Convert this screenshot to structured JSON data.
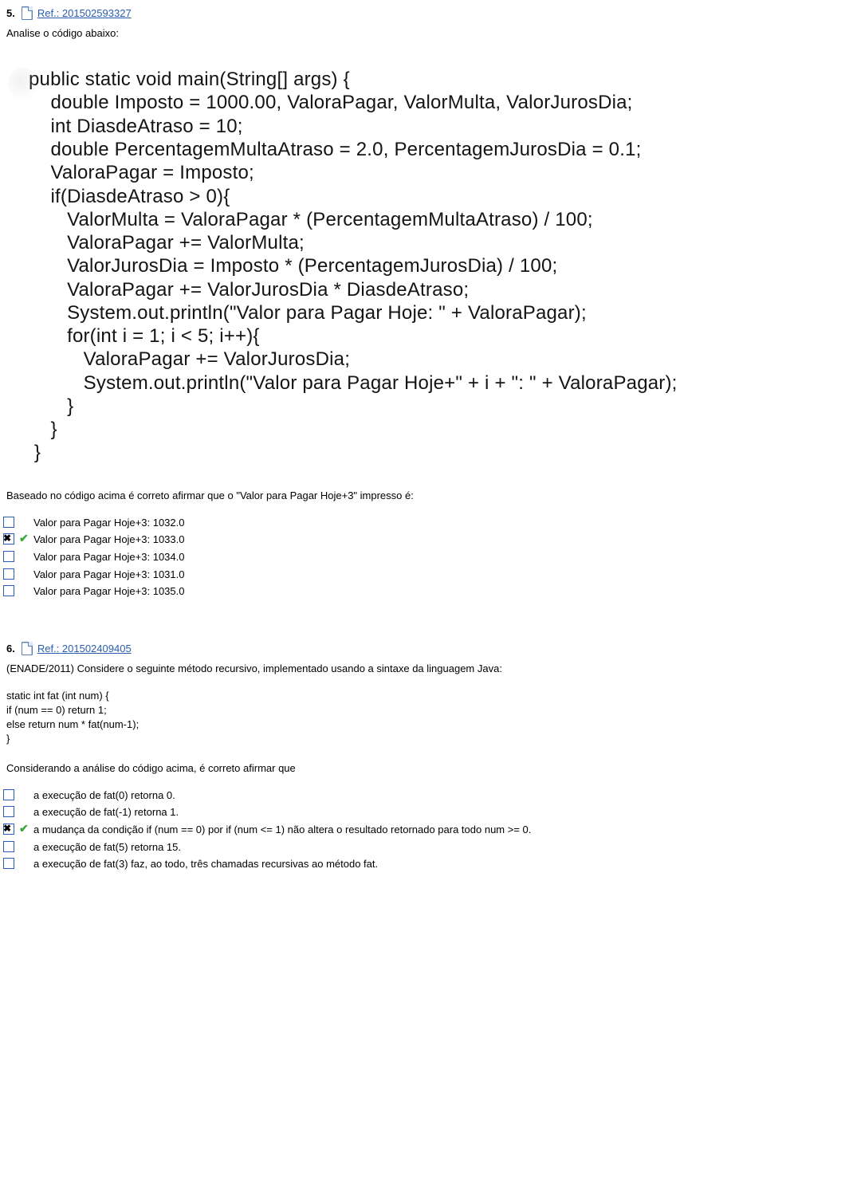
{
  "q1": {
    "number": "5.",
    "ref_label": "Ref.: 201502593327",
    "stem": "Analise o código abaixo:",
    "code": "public static void main(String[] args) {\n    double Imposto = 1000.00, ValoraPagar, ValorMulta, ValorJurosDia;\n    int DiasdeAtraso = 10;\n    double PercentagemMultaAtraso = 2.0, PercentagemJurosDia = 0.1;\n    ValoraPagar = Imposto;\n    if(DiasdeAtraso > 0){\n       ValorMulta = ValoraPagar * (PercentagemMultaAtraso) / 100;\n       ValoraPagar += ValorMulta;\n       ValorJurosDia = Imposto * (PercentagemJurosDia) / 100;\n       ValoraPagar += ValorJurosDia * DiasdeAtraso;\n       System.out.println(\"Valor para Pagar Hoje: \" + ValoraPagar);\n       for(int i = 1; i < 5; i++){\n          ValoraPagar += ValorJurosDia;\n          System.out.println(\"Valor para Pagar Hoje+\" + i + \": \" + ValoraPagar);\n       }\n    }\n }",
    "after": "Baseado no código acima é correto afirmar que o \"Valor para Pagar Hoje+3\" impresso é:",
    "options": [
      {
        "letter": "",
        "checked": false,
        "correct": false,
        "text": "Valor para Pagar Hoje+3: 1032.0"
      },
      {
        "letter": "",
        "checked": true,
        "correct": true,
        "text": "Valor para Pagar Hoje+3: 1033.0"
      },
      {
        "letter": "",
        "checked": false,
        "correct": false,
        "text": "Valor para Pagar Hoje+3: 1034.0"
      },
      {
        "letter": "",
        "checked": false,
        "correct": false,
        "text": "Valor para Pagar Hoje+3: 1031.0"
      },
      {
        "letter": "",
        "checked": false,
        "correct": false,
        "text": "Valor para Pagar Hoje+3: 1035.0"
      }
    ]
  },
  "q2": {
    "number": "6.",
    "ref_label": "Ref.: 201502409405",
    "stem": "(ENADE/2011) Considere o seguinte método recursivo, implementado usando a sintaxe da linguagem Java:",
    "body": "static int fat (int num) {\nif (num == 0) return 1;\nelse return num * fat(num-1);\n}\n\nConsiderando a análise do código acima, é correto afirmar que",
    "options": [
      {
        "letter": "",
        "checked": false,
        "correct": false,
        "text": "a execução de fat(0) retorna 0."
      },
      {
        "letter": "",
        "checked": false,
        "correct": false,
        "text": "a execução de fat(-1) retorna 1."
      },
      {
        "letter": "",
        "checked": true,
        "correct": true,
        "text": "a mudança da condição if (num == 0) por if (num <= 1) não altera o resultado retornado para todo num >= 0."
      },
      {
        "letter": "",
        "checked": false,
        "correct": false,
        "text": "a execução de fat(5) retorna 15."
      },
      {
        "letter": "",
        "checked": false,
        "correct": false,
        "text": "a execução de fat(3) faz, ao todo, três chamadas recursivas ao método fat."
      }
    ]
  }
}
